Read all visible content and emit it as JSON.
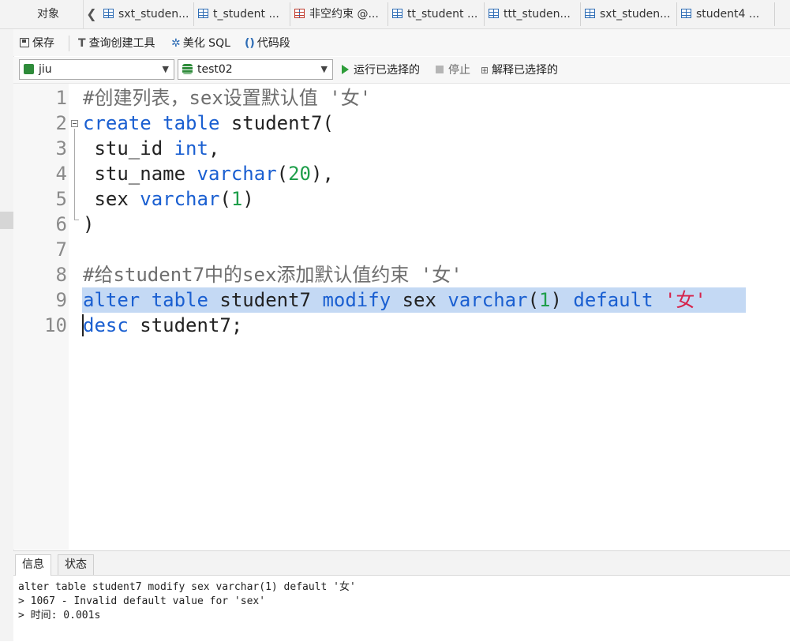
{
  "tabs": {
    "objects": "对象",
    "items": [
      {
        "label": "sxt_studen...",
        "icon": "table-icon"
      },
      {
        "label": "t_student ...",
        "icon": "table-icon"
      },
      {
        "label": "非空约束 @...",
        "icon": "query-icon"
      },
      {
        "label": "tt_student ...",
        "icon": "table-icon"
      },
      {
        "label": "ttt_studen...",
        "icon": "table-icon"
      },
      {
        "label": "sxt_studen...",
        "icon": "table-icon"
      },
      {
        "label": "student4 ...",
        "icon": "table-icon"
      }
    ]
  },
  "toolbar": {
    "save": "保存",
    "query_builder": "查询创建工具",
    "beautify": "美化 SQL",
    "snippet": "代码段"
  },
  "dbbar": {
    "connection": "jiu",
    "database": "test02",
    "run_selected": "运行已选择的",
    "stop": "停止",
    "explain_selected": "解释已选择的"
  },
  "editor": {
    "line_numbers": [
      "1",
      "2",
      "3",
      "4",
      "5",
      "6",
      "7",
      "8",
      "9",
      "10"
    ],
    "lines": {
      "l1": "#创建列表，sex设置默认值 '女'",
      "l2_kw1": "create",
      "l2_kw2": "table",
      "l2_rest": " student7(",
      "l3_a": " stu_id ",
      "l3_kw": "int",
      "l3_b": ",",
      "l4_a": " stu_name ",
      "l4_kw": "varchar",
      "l4_b": "(",
      "l4_num": "20",
      "l4_c": "),",
      "l5_a": " sex ",
      "l5_kw": "varchar",
      "l5_b": "(",
      "l5_num": "1",
      "l5_c": ")",
      "l6": ")",
      "l8": "#给student7中的sex添加默认值约束 '女'",
      "l9_kw1": "alter",
      "l9_kw2": "table",
      "l9_a": " student7 ",
      "l9_kw3": "modify",
      "l9_b": " sex ",
      "l9_kw4": "varchar",
      "l9_c": "(",
      "l9_num": "1",
      "l9_d": ") ",
      "l9_kw5": "default",
      "l9_str": "'女'",
      "l10_kw": "desc",
      "l10_rest": " student7;"
    }
  },
  "panel": {
    "tab_info": "信息",
    "tab_status": "状态",
    "messages": [
      "alter table student7 modify sex varchar(1) default '女'",
      "> 1067 - Invalid default value for 'sex'",
      "> 时间: 0.001s"
    ]
  }
}
